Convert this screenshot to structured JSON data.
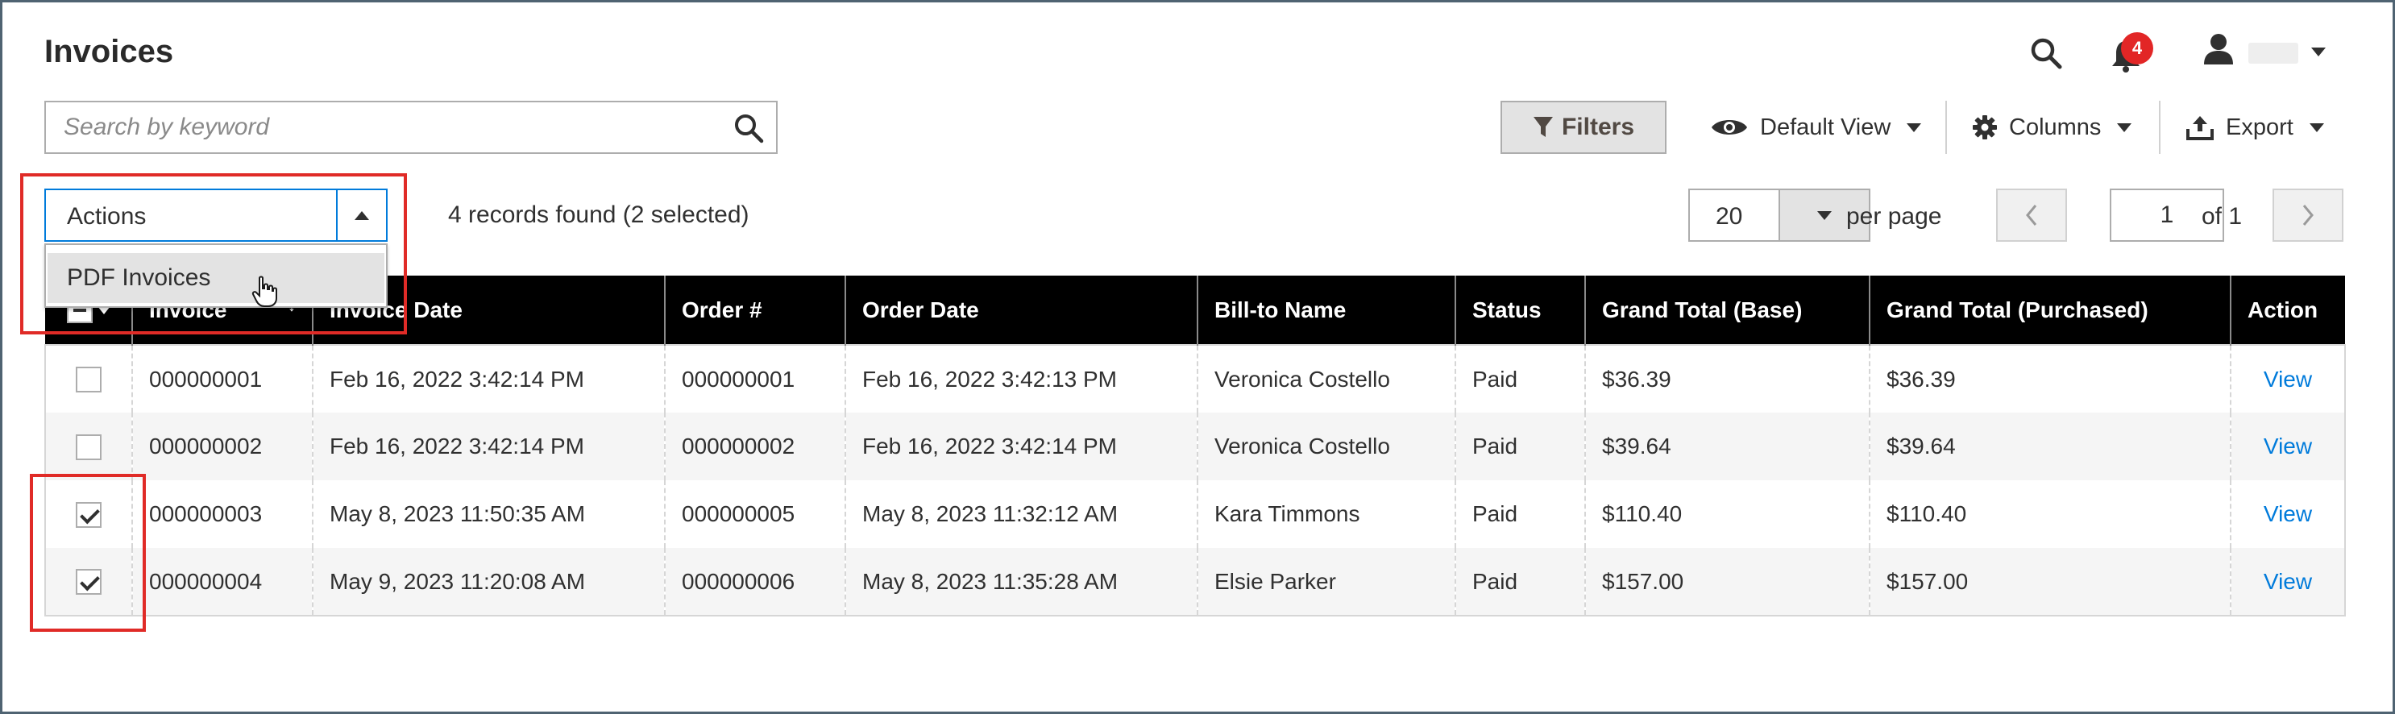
{
  "page": {
    "title": "Invoices"
  },
  "header": {
    "notifications_count": "4",
    "icons": [
      "search-icon",
      "bell-icon",
      "user-icon",
      "chevron-down-icon"
    ]
  },
  "search": {
    "placeholder": "Search by keyword"
  },
  "toolbar": {
    "filters_label": "Filters",
    "view_label": "Default View",
    "columns_label": "Columns",
    "export_label": "Export"
  },
  "actions": {
    "label": "Actions",
    "menu_items": [
      "PDF Invoices"
    ]
  },
  "records_text": "4 records found (2 selected)",
  "pagination": {
    "per_page_value": "20",
    "per_page_label": "per page",
    "current_page": "1",
    "of_label": "of 1"
  },
  "grid": {
    "columns": [
      "Invoice",
      "Invoice Date",
      "Order #",
      "Order Date",
      "Bill-to Name",
      "Status",
      "Grand Total (Base)",
      "Grand Total (Purchased)",
      "Action"
    ],
    "rows": [
      {
        "checked": false,
        "invoice": "000000001",
        "invoice_date": "Feb 16, 2022 3:42:14 PM",
        "order": "000000001",
        "order_date": "Feb 16, 2022 3:42:13 PM",
        "bill_to": "Veronica Costello",
        "status": "Paid",
        "grand_base": "$36.39",
        "grand_purchased": "$36.39",
        "action": "View"
      },
      {
        "checked": false,
        "invoice": "000000002",
        "invoice_date": "Feb 16, 2022 3:42:14 PM",
        "order": "000000002",
        "order_date": "Feb 16, 2022 3:42:14 PM",
        "bill_to": "Veronica Costello",
        "status": "Paid",
        "grand_base": "$39.64",
        "grand_purchased": "$39.64",
        "action": "View"
      },
      {
        "checked": true,
        "invoice": "000000003",
        "invoice_date": "May 8, 2023 11:50:35 AM",
        "order": "000000005",
        "order_date": "May 8, 2023 11:32:12 AM",
        "bill_to": "Kara Timmons",
        "status": "Paid",
        "grand_base": "$110.40",
        "grand_purchased": "$110.40",
        "action": "View"
      },
      {
        "checked": true,
        "invoice": "000000004",
        "invoice_date": "May 9, 2023 11:20:08 AM",
        "order": "000000006",
        "order_date": "May 8, 2023 11:35:28 AM",
        "bill_to": "Elsie Parker",
        "status": "Paid",
        "grand_base": "$157.00",
        "grand_purchased": "$157.00",
        "action": "View"
      }
    ]
  },
  "colors": {
    "accent": "#007bdb",
    "highlight": "#e02b27",
    "badge": "#e22626",
    "header_bg": "#000000"
  }
}
